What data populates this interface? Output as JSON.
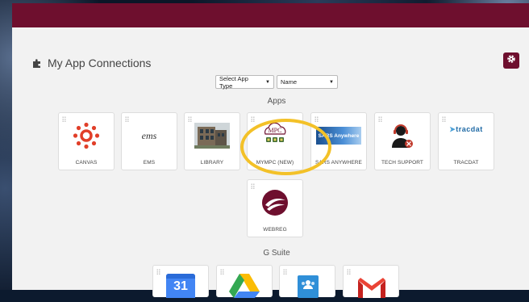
{
  "heading": {
    "title": "My App Connections",
    "icon": "puzzle-icon"
  },
  "settings": {
    "icon": "gear-icon"
  },
  "filters": {
    "app_type": "Select App Type",
    "sort": "Name"
  },
  "sections": [
    {
      "title": "Apps",
      "tiles": [
        {
          "label": "CANVAS",
          "icon": "canvas-logo"
        },
        {
          "label": "EMS",
          "icon": "ems-logo",
          "logo_text": "ems"
        },
        {
          "label": "LIBRARY",
          "icon": "library-photo"
        },
        {
          "label": "MYMPC (NEW)",
          "icon": "mympc-logo",
          "logo_text": "MPC"
        },
        {
          "label": "SARS ANYWHERE",
          "icon": "sars-logo",
          "logo_text": "SARS Anywhere"
        },
        {
          "label": "TECH SUPPORT",
          "icon": "tech-support-icon"
        },
        {
          "label": "TRACDAT",
          "icon": "tracdat-logo",
          "logo_text": "tracdat"
        },
        {
          "label": "WEBREG",
          "icon": "webreg-logo"
        }
      ]
    },
    {
      "title": "G Suite",
      "tiles": [
        {
          "label": "",
          "icon": "google-calendar-icon",
          "logo_text": "31"
        },
        {
          "label": "",
          "icon": "google-drive-icon"
        },
        {
          "label": "",
          "icon": "google-classroom-icon"
        },
        {
          "label": "",
          "icon": "gmail-icon"
        }
      ]
    }
  ],
  "colors": {
    "brand": "#6e0f2e",
    "highlight": "#f3c128"
  }
}
